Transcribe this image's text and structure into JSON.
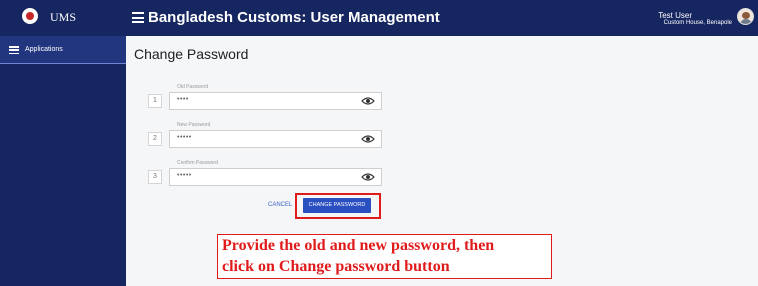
{
  "topbar": {
    "brand": "UMS",
    "title": "Bangladesh Customs: User Management",
    "user_name": "Test User",
    "user_location": "Custom House, Benapole"
  },
  "sidebar": {
    "items": [
      {
        "label": "Applications",
        "icon": "list-icon"
      }
    ]
  },
  "page": {
    "title": "Change Password"
  },
  "form": {
    "fields": [
      {
        "number": "1",
        "label": "Old Password",
        "value": "••••"
      },
      {
        "number": "2",
        "label": "New Password",
        "value": "•••••"
      },
      {
        "number": "3",
        "label": "Confirm Password",
        "value": "•••••"
      }
    ],
    "cancel_label": "CANCEL",
    "submit_label": "CHANGE PASSWORD"
  },
  "annotation": {
    "line1": "Provide the old and new password, then",
    "line2": "click on Change password button",
    "color": "#e01b1b"
  },
  "colors": {
    "navbar": "#162660",
    "sidebar_active": "#22357f",
    "primary_button": "#2a4fc1"
  }
}
